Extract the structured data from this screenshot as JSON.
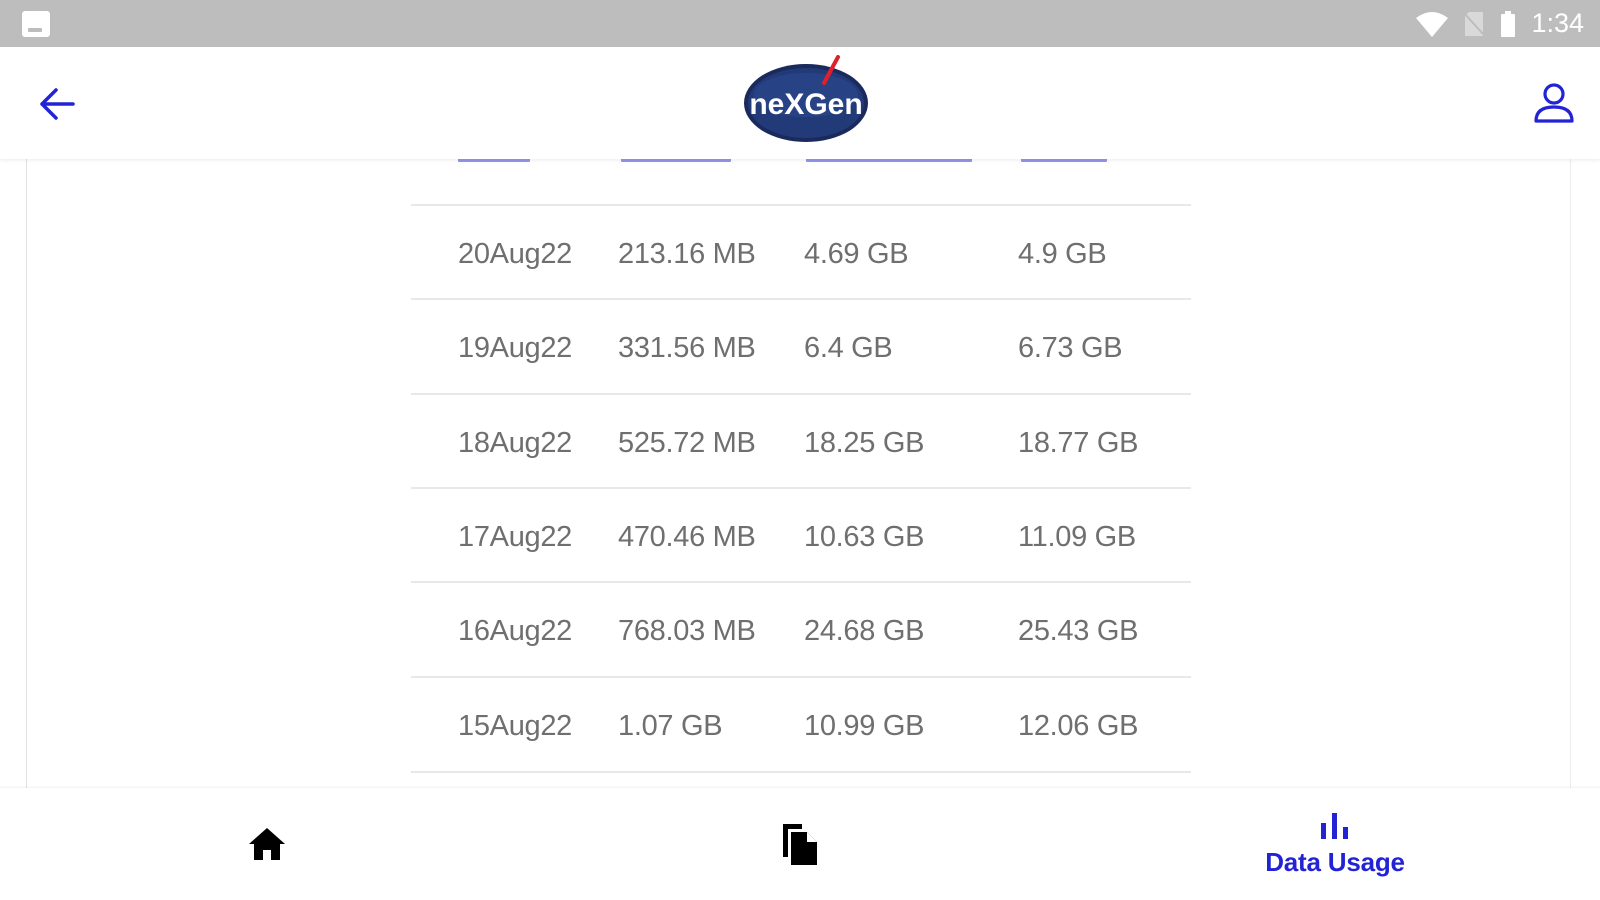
{
  "status_bar": {
    "time": "1:34",
    "icons": [
      "image-icon",
      "wifi-icon",
      "no-sim-icon",
      "battery-icon"
    ]
  },
  "app_bar": {
    "back_icon": "arrow-left-icon",
    "logo_text": "neXGen",
    "profile_icon": "person-icon"
  },
  "usage_table": {
    "rows": [
      {
        "date": "20Aug22",
        "upload": "213.16 MB",
        "download": "4.69 GB",
        "total": "4.9 GB"
      },
      {
        "date": "19Aug22",
        "upload": "331.56 MB",
        "download": "6.4 GB",
        "total": "6.73 GB"
      },
      {
        "date": "18Aug22",
        "upload": "525.72 MB",
        "download": "18.25 GB",
        "total": "18.77 GB"
      },
      {
        "date": "17Aug22",
        "upload": "470.46 MB",
        "download": "10.63 GB",
        "total": "11.09 GB"
      },
      {
        "date": "16Aug22",
        "upload": "768.03 MB",
        "download": "24.68 GB",
        "total": "25.43 GB"
      },
      {
        "date": "15Aug22",
        "upload": "1.07 GB",
        "download": "10.99 GB",
        "total": "12.06 GB"
      }
    ]
  },
  "bottom_nav": {
    "items": [
      {
        "icon": "home-icon",
        "label": ""
      },
      {
        "icon": "documents-icon",
        "label": ""
      },
      {
        "icon": "bar-chart-icon",
        "label": "Data Usage"
      }
    ],
    "active": "Data Usage"
  },
  "colors": {
    "accent": "#2323d6",
    "status_bar": "#bdbdbd",
    "text_cell": "#6f6f6f",
    "logo_bg": "#1c2f66"
  }
}
